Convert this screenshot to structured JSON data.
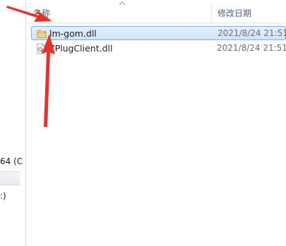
{
  "columns": {
    "name_header": "名称",
    "date_header": "修改日期"
  },
  "files": [
    {
      "name": "lm-gom.dll",
      "modified": "2021/8/24 21:51",
      "icon": "folder-icon",
      "selected": true
    },
    {
      "name": "ZPlugClient.dll",
      "modified": "2021/8/24 21:51",
      "icon": "dll-file-icon",
      "selected": false
    }
  ],
  "nav_pane": {
    "partial_label_1": "64 (C",
    "partial_label_2": ":)"
  },
  "annotation": {
    "color": "#e8312b",
    "description_icon": "red-arrow-icon"
  }
}
